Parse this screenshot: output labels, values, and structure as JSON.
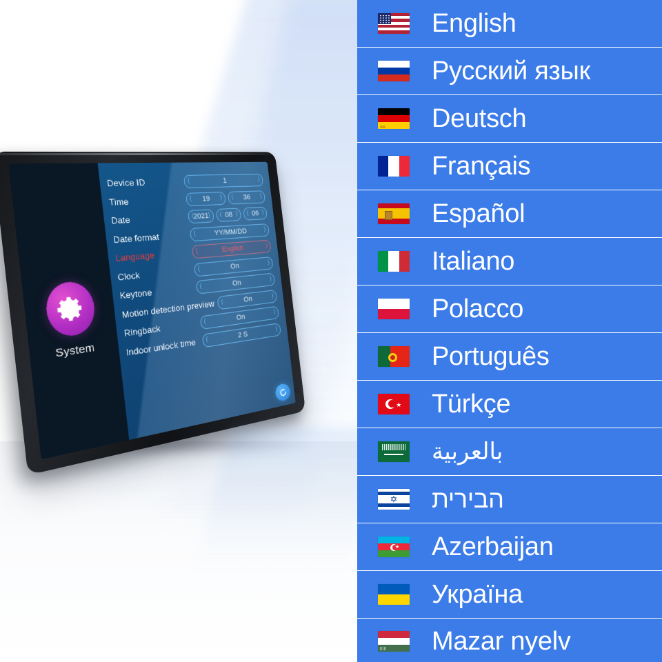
{
  "scene": {
    "device": {
      "system_label": "System",
      "system_icon": "gear-icon",
      "back_icon": "refresh-back-icon",
      "settings_rows": [
        {
          "label": "Device ID",
          "values": [
            "1"
          ]
        },
        {
          "label": "Time",
          "values": [
            "19",
            "36"
          ]
        },
        {
          "label": "Date",
          "values": [
            "2021",
            "08",
            "06"
          ]
        },
        {
          "label": "Date format",
          "values": [
            "YY/MM/DD"
          ]
        },
        {
          "label": "Language",
          "values": [
            "English"
          ],
          "highlight": true
        },
        {
          "label": "Clock",
          "values": [
            "On"
          ]
        },
        {
          "label": "Keytone",
          "values": [
            "On"
          ]
        },
        {
          "label": "Motion detection preview",
          "values": [
            "On"
          ]
        },
        {
          "label": "Ringback",
          "values": [
            "On"
          ]
        },
        {
          "label": "Indoor unlock time",
          "values": [
            "2 S"
          ]
        }
      ]
    }
  },
  "language_list": {
    "accent_color": "#3b7ce8",
    "text_color": "#ffffff",
    "items": [
      {
        "flag": "flag-us-icon",
        "name": "English"
      },
      {
        "flag": "flag-ru-icon",
        "name": "Русский язык"
      },
      {
        "flag": "flag-de-icon",
        "name": "Deutsch"
      },
      {
        "flag": "flag-fr-icon",
        "name": "Français"
      },
      {
        "flag": "flag-es-icon",
        "name": "Español"
      },
      {
        "flag": "flag-it-icon",
        "name": "Italiano"
      },
      {
        "flag": "flag-pl-icon",
        "name": "Polacco"
      },
      {
        "flag": "flag-pt-icon",
        "name": "Português"
      },
      {
        "flag": "flag-tr-icon",
        "name": "Türkçe"
      },
      {
        "flag": "flag-sa-icon",
        "name": "بالعربية"
      },
      {
        "flag": "flag-il-icon",
        "name": "הבירית"
      },
      {
        "flag": "flag-az-icon",
        "name": "Azerbaijan"
      },
      {
        "flag": "flag-ua-icon",
        "name": "Україна"
      },
      {
        "flag": "flag-hu-icon",
        "name": "Mazar nyelv"
      }
    ]
  }
}
